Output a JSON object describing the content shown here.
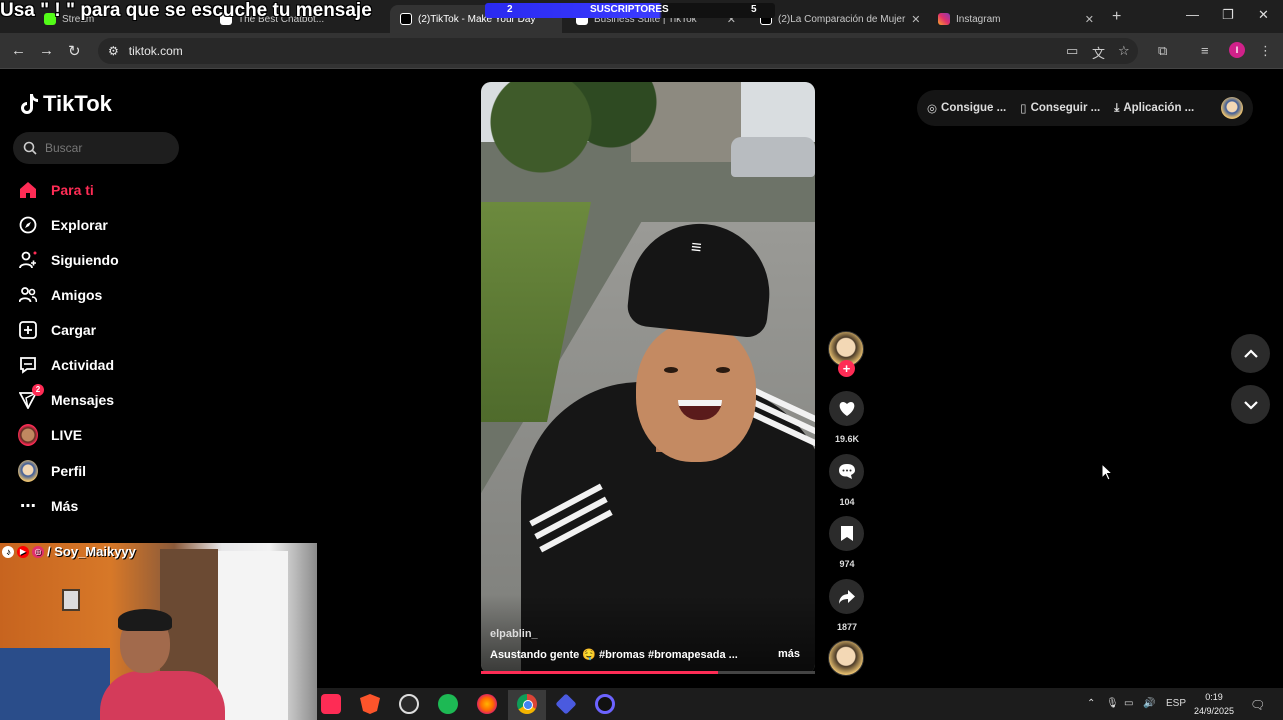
{
  "overlay": {
    "title": "Usa \" ! \" para que se escuche tu mensaje",
    "subs_left": "2",
    "subs_label": "SUSCRIPTORES",
    "subs_right": "5"
  },
  "browser": {
    "tabs": [
      {
        "label": "Stream",
        "color": "#53fc18",
        "active": false
      },
      {
        "label": "The Best Chatbot...",
        "color": "#ffffff",
        "active": false
      },
      {
        "label": "(2)TikTok - Make Your Day",
        "color": "#ffffff",
        "active": true
      },
      {
        "label": "Business Suite | TikTok",
        "color": "#ffffff",
        "active": false
      },
      {
        "label": "(2)La Comparación de Mujer",
        "color": "#ffffff",
        "active": false
      },
      {
        "label": "Instagram",
        "color": "#e1306c",
        "active": false
      }
    ],
    "url": "tiktok.com",
    "profile_initial": "I"
  },
  "tiktok": {
    "logo_text": "TikTok",
    "search_placeholder": "Buscar",
    "nav": [
      {
        "label": "Para ti",
        "icon": "home-icon",
        "active": true
      },
      {
        "label": "Explorar",
        "icon": "compass-icon",
        "active": false
      },
      {
        "label": "Siguiendo",
        "icon": "following-icon",
        "active": false
      },
      {
        "label": "Amigos",
        "icon": "friends-icon",
        "active": false
      },
      {
        "label": "Cargar",
        "icon": "upload-icon",
        "active": false
      },
      {
        "label": "Actividad",
        "icon": "activity-icon",
        "active": false
      },
      {
        "label": "Mensajes",
        "icon": "messages-icon",
        "active": false,
        "badge": "2"
      },
      {
        "label": "LIVE",
        "icon": "live-icon",
        "active": false
      },
      {
        "label": "Perfil",
        "icon": "profile-icon",
        "active": false
      },
      {
        "label": "Más",
        "icon": "more-icon",
        "active": false
      }
    ],
    "top_pills": [
      {
        "label": "Consigue ...",
        "icon": "coin-icon"
      },
      {
        "label": "Conseguir ...",
        "icon": "phone-icon"
      },
      {
        "label": "Aplicación ...",
        "icon": "download-icon"
      }
    ],
    "video": {
      "username": "elpablin_",
      "caption": "Asustando gente 🤤 #bromas #bromapesada ...",
      "more_label": "más",
      "progress": 0.71
    },
    "actions": {
      "likes": "19.6K",
      "comments": "104",
      "saves": "974",
      "shares": "1877"
    }
  },
  "webcam": {
    "handle": "/ Soy_Maikyyy"
  },
  "taskbar": {
    "language": "ESP",
    "time": "0:19",
    "date": "24/9/2025"
  },
  "colors": {
    "accent": "#fe2c55",
    "background": "#000000",
    "chrome_bar": "#333333"
  }
}
